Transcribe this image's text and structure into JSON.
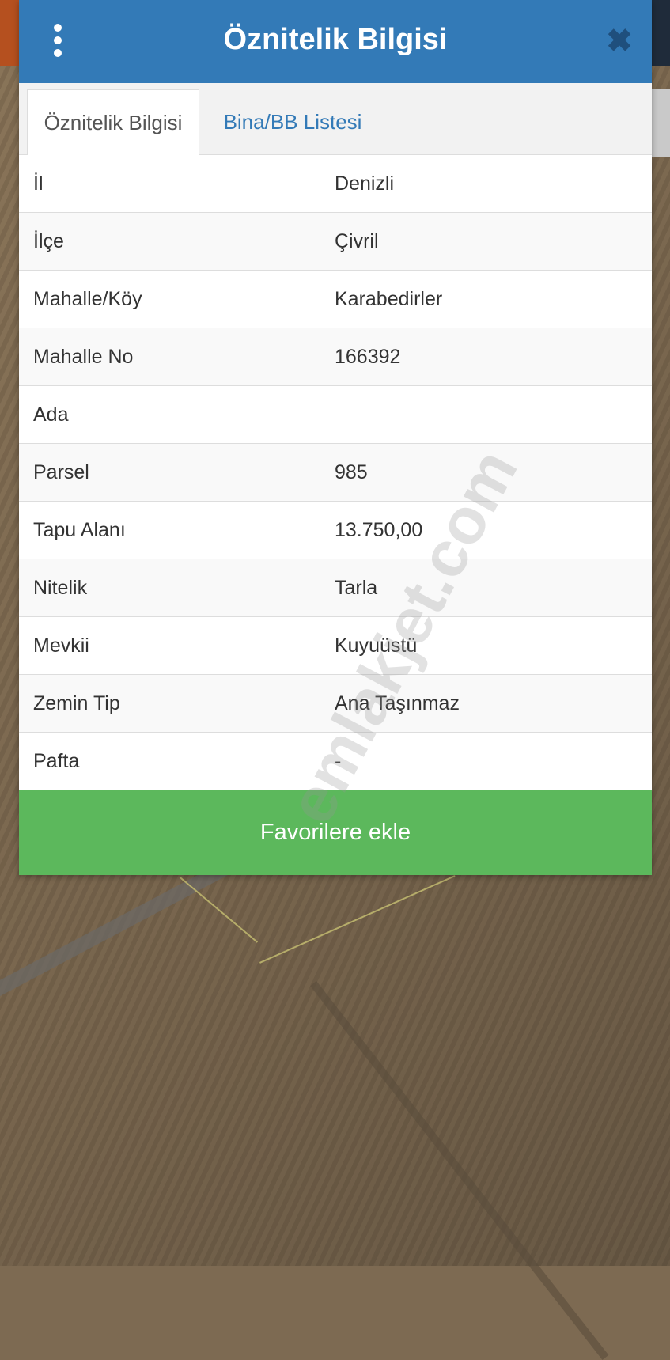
{
  "dialog": {
    "title": "Öznitelik Bilgisi",
    "icons": {
      "menu": "vertical-dots-icon",
      "close": "close-icon"
    },
    "tabs": [
      {
        "label": "Öznitelik Bilgisi",
        "active": true
      },
      {
        "label": "Bina/BB Listesi",
        "active": false
      }
    ],
    "rows": [
      {
        "key": "İl",
        "value": "Denizli"
      },
      {
        "key": "İlçe",
        "value": "Çivril"
      },
      {
        "key": "Mahalle/Köy",
        "value": "Karabedirler"
      },
      {
        "key": "Mahalle No",
        "value": "166392"
      },
      {
        "key": "Ada",
        "value": ""
      },
      {
        "key": "Parsel",
        "value": "985"
      },
      {
        "key": "Tapu Alanı",
        "value": "13.750,00"
      },
      {
        "key": "Nitelik",
        "value": "Tarla"
      },
      {
        "key": "Mevkii",
        "value": "Kuyuüstü"
      },
      {
        "key": "Zemin Tip",
        "value": "Ana Taşınmaz"
      },
      {
        "key": "Pafta",
        "value": "-"
      }
    ],
    "favorite_button": "Favorilere ekle"
  },
  "watermark": "emlakjet.com",
  "colors": {
    "header": "#337ab7",
    "tab_link": "#337ab7",
    "favorite_button": "#5cb85c",
    "close_icon": "#1f4f7d"
  }
}
